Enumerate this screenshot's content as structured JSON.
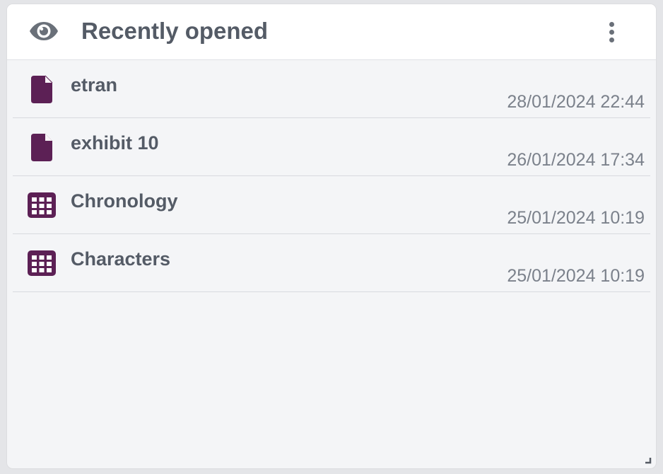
{
  "widget": {
    "title": "Recently opened",
    "title_icon": "eye-icon",
    "menu_icon": "kebab-menu-icon"
  },
  "items": [
    {
      "name": "etran",
      "date": "28/01/2024 22:44",
      "icon": "document-icon"
    },
    {
      "name": "exhibit 10",
      "date": "26/01/2024 17:34",
      "icon": "document-icon"
    },
    {
      "name": "Chronology",
      "date": "25/01/2024 10:19",
      "icon": "table-grid-icon"
    },
    {
      "name": "Characters",
      "date": "25/01/2024 10:19",
      "icon": "table-grid-icon"
    }
  ],
  "colors": {
    "icon_accent": "#5c2055",
    "text_primary": "#545b66",
    "text_secondary": "#7b818b"
  }
}
